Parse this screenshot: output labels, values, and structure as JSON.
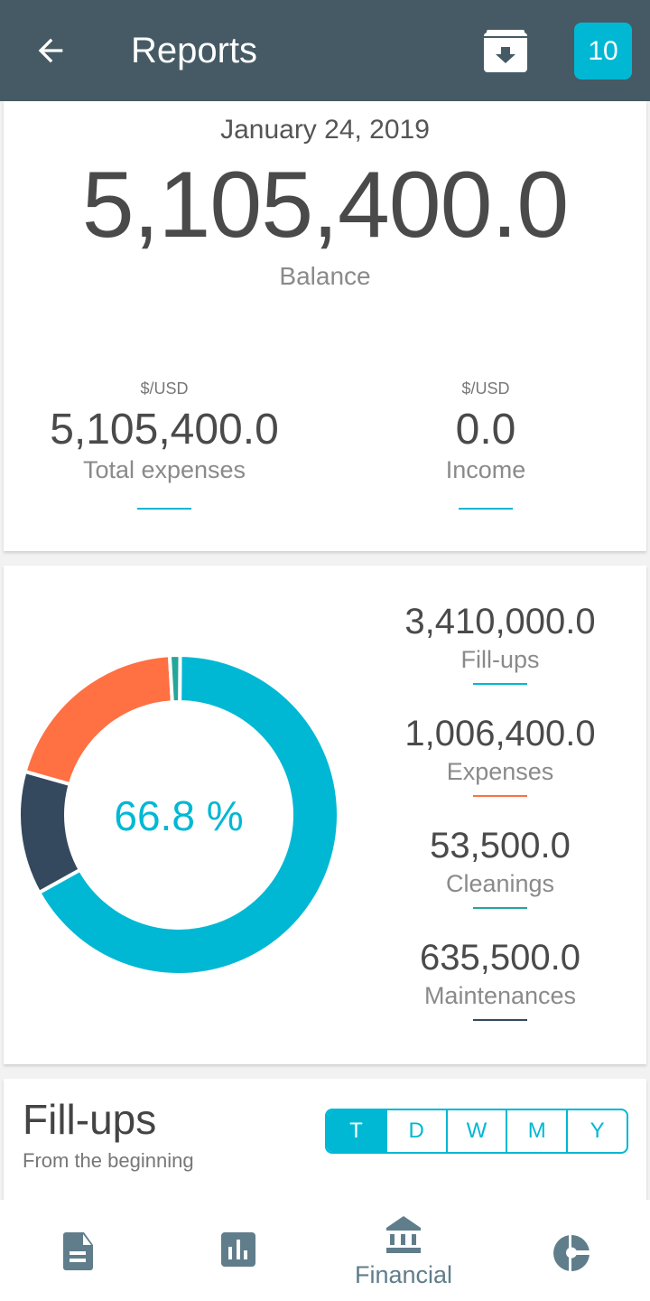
{
  "appbar": {
    "title": "Reports",
    "badge": "10",
    "icons": [
      "arrow-back-icon",
      "archive-download-icon"
    ]
  },
  "summary": {
    "date": "January 24, 2019",
    "balance": "5,105,400.0",
    "balance_label": "Balance",
    "expenses": {
      "currency": "$/USD",
      "value": "5,105,400.0",
      "label": "Total expenses"
    },
    "income": {
      "currency": "$/USD",
      "value": "0.0",
      "label": "Income"
    }
  },
  "chart_data": {
    "type": "pie",
    "center_label": "66.8 %",
    "categories": [
      "Fill-ups",
      "Expenses",
      "Cleanings",
      "Maintenances"
    ],
    "values": [
      3410000.0,
      1006400.0,
      53500.0,
      635500.0
    ],
    "labels": [
      "3,410,000.0",
      "1,006,400.0",
      "53,500.0",
      "635,500.0"
    ],
    "colors": [
      "#00b8d4",
      "#ff7043",
      "#26a69a",
      "#34495e"
    ]
  },
  "section": {
    "title": "Fill-ups",
    "subtitle": "From the beginning",
    "periods": [
      "T",
      "D",
      "W",
      "M",
      "Y"
    ],
    "selected": "T"
  },
  "nav": {
    "items": [
      {
        "icon": "document-icon",
        "label": ""
      },
      {
        "icon": "bar-chart-icon",
        "label": ""
      },
      {
        "icon": "bank-icon",
        "label": "Financial"
      },
      {
        "icon": "pie-chart-icon",
        "label": ""
      }
    ],
    "active": "Financial",
    "color": "#607d8b"
  }
}
